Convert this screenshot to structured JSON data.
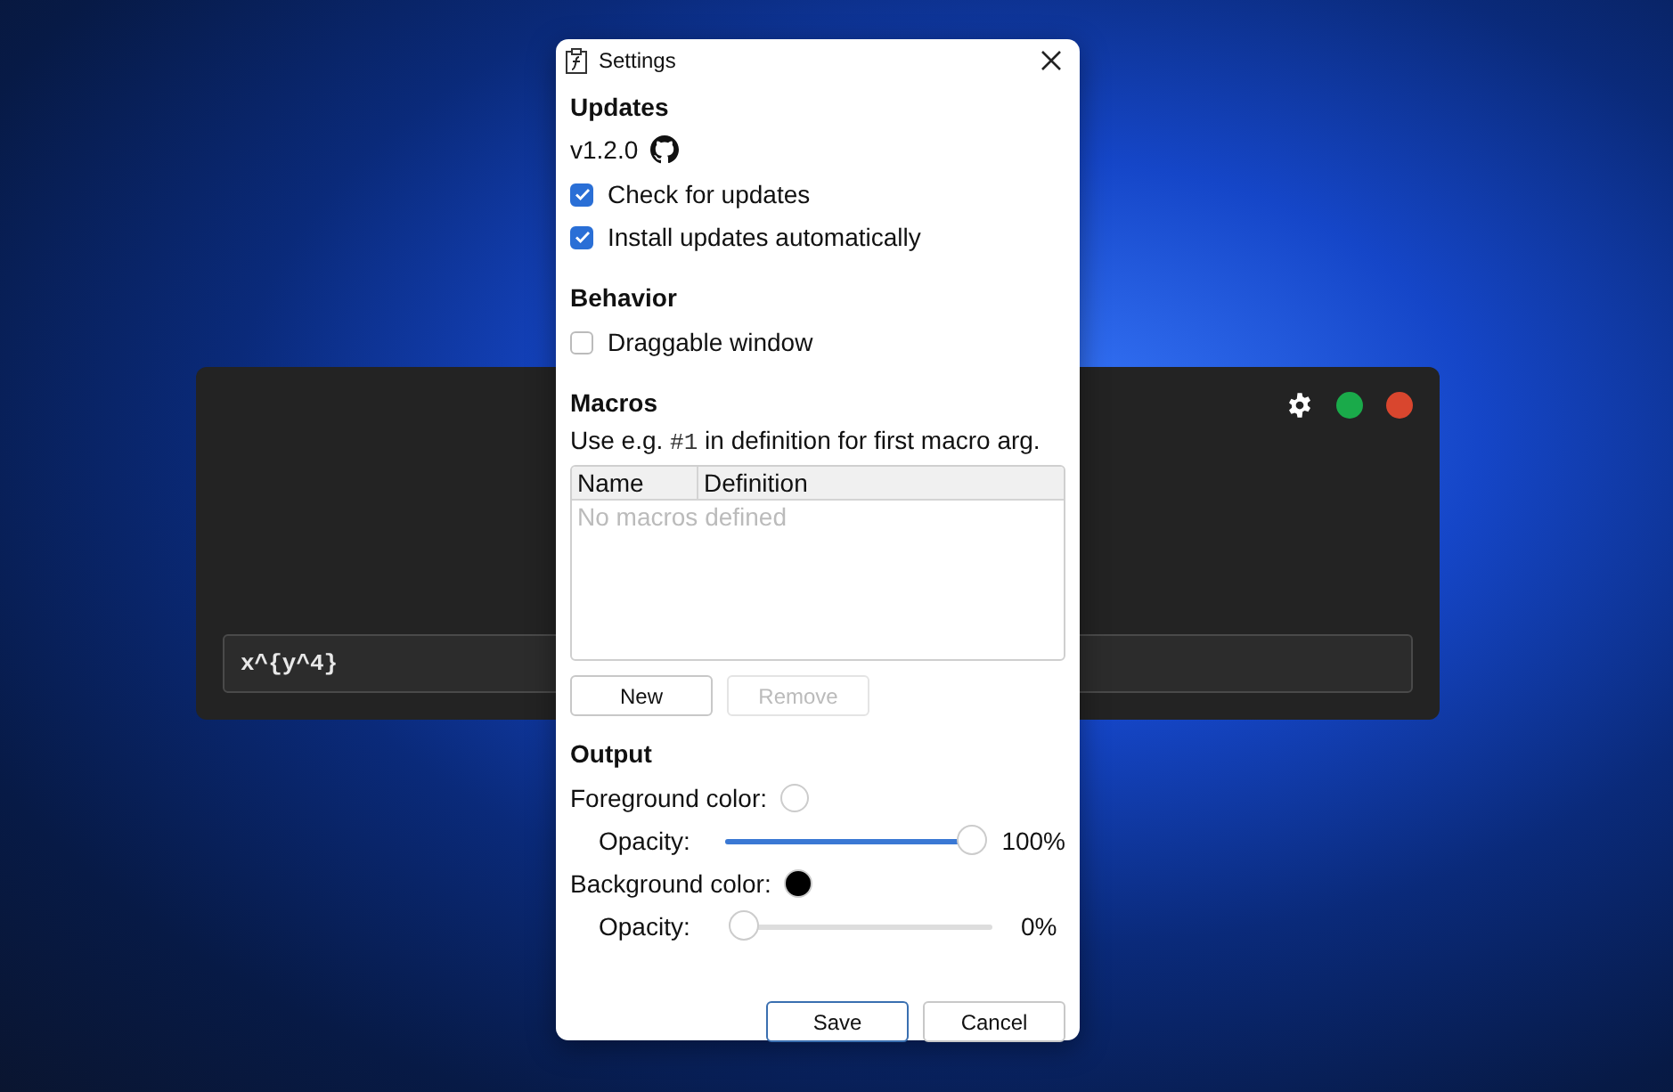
{
  "app_window": {
    "input": {
      "value": "x^{y^4}"
    },
    "status_dots": [
      {
        "color": "#1aaa4a"
      },
      {
        "color": "#d9462e"
      }
    ]
  },
  "dialog": {
    "title": "Settings",
    "updates": {
      "heading": "Updates",
      "version": "v1.2.0",
      "options": [
        {
          "label": "Check for updates",
          "checked": true
        },
        {
          "label": "Install updates automatically",
          "checked": true
        }
      ]
    },
    "behavior": {
      "heading": "Behavior",
      "options": [
        {
          "label": "Draggable window",
          "checked": false
        }
      ]
    },
    "macros": {
      "heading": "Macros",
      "hint": [
        {
          "kind": "text",
          "text": "Use e.g. "
        },
        {
          "kind": "code",
          "text": "#1"
        },
        {
          "kind": "text",
          "text": " in definition for first macro arg."
        }
      ],
      "table": {
        "columns": [
          "Name",
          "Definition"
        ],
        "empty_text": "No macros defined"
      },
      "buttons": [
        {
          "label": "New",
          "disabled": false
        },
        {
          "label": "Remove",
          "disabled": true
        }
      ]
    },
    "output": {
      "heading": "Output",
      "colors": [
        {
          "label": "Foreground color:",
          "color": "#ffffff",
          "opacity_label": "Opacity:",
          "level": 1,
          "reading": "100%"
        },
        {
          "label": "Background color:",
          "color": "#000000",
          "opacity_label": "Opacity:",
          "level": 0,
          "reading": "0%"
        }
      ]
    },
    "buttons": [
      {
        "label": "Save",
        "default": true
      },
      {
        "label": "Cancel",
        "default": false
      }
    ]
  }
}
